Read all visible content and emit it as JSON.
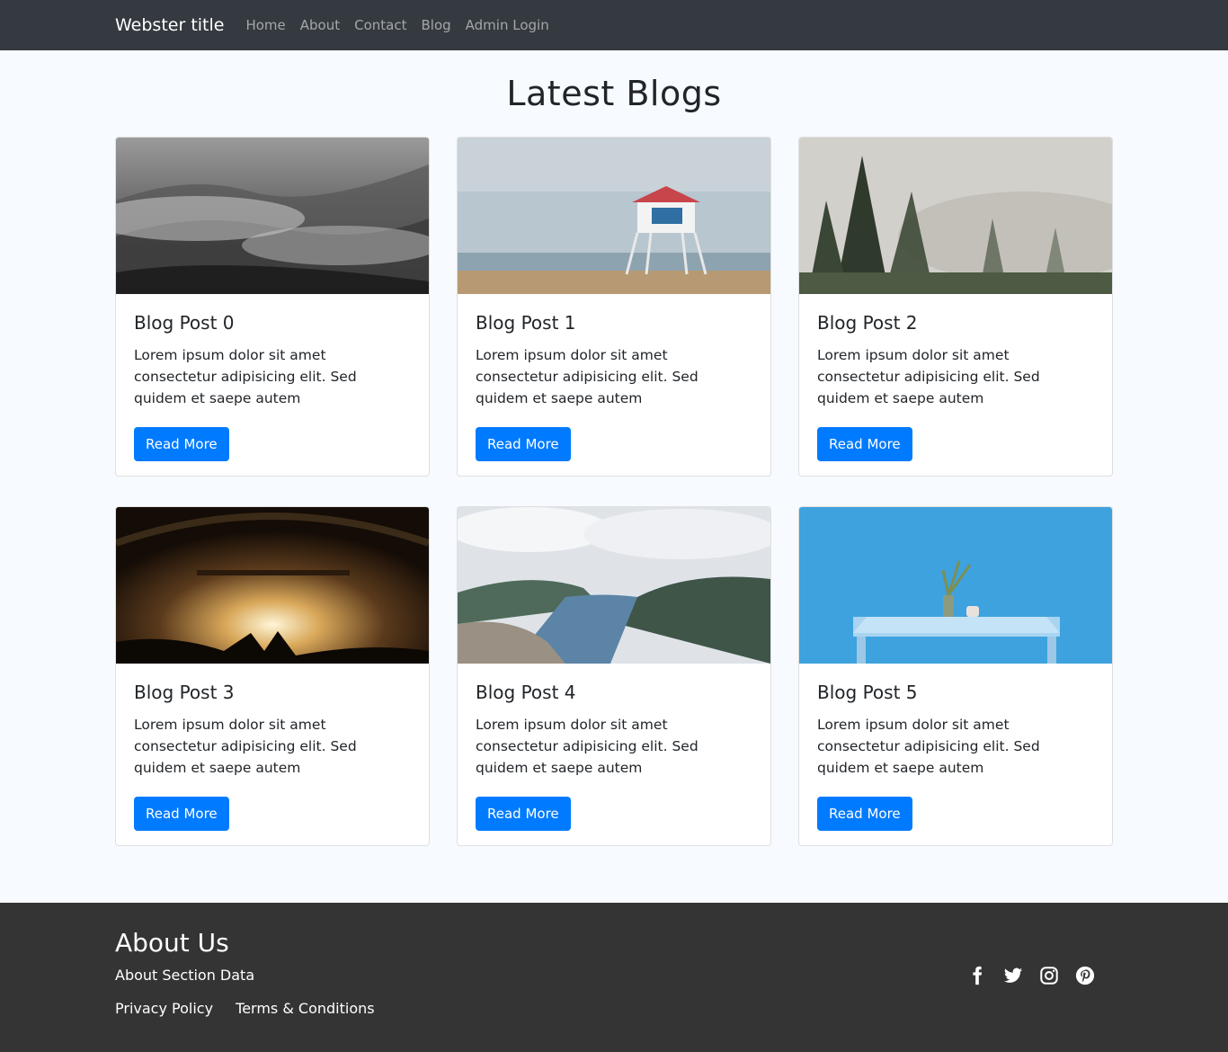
{
  "nav": {
    "brand": "Webster title",
    "links": [
      "Home",
      "About",
      "Contact",
      "Blog",
      "Admin Login"
    ]
  },
  "main": {
    "title": "Latest Blogs",
    "posts": [
      {
        "title": "Blog Post 0",
        "text": "Lorem ipsum dolor sit amet consectetur adipisicing elit. Sed quidem et saepe autem",
        "button": "Read More",
        "image": "misty-forest-grayscale"
      },
      {
        "title": "Blog Post 1",
        "text": "Lorem ipsum dolor sit amet consectetur adipisicing elit. Sed quidem et saepe autem",
        "button": "Read More",
        "image": "lifeguard-tower-beach"
      },
      {
        "title": "Blog Post 2",
        "text": "Lorem ipsum dolor sit amet consectetur adipisicing elit. Sed quidem et saepe autem",
        "button": "Read More",
        "image": "foggy-pine-trees"
      },
      {
        "title": "Blog Post 3",
        "text": "Lorem ipsum dolor sit amet consectetur adipisicing elit. Sed quidem et saepe autem",
        "button": "Read More",
        "image": "concert-crowd-stage"
      },
      {
        "title": "Blog Post 4",
        "text": "Lorem ipsum dolor sit amet consectetur adipisicing elit. Sed quidem et saepe autem",
        "button": "Read More",
        "image": "fjord-mountains"
      },
      {
        "title": "Blog Post 5",
        "text": "Lorem ipsum dolor sit amet consectetur adipisicing elit. Sed quidem et saepe autem",
        "button": "Read More",
        "image": "blue-wall-table"
      }
    ]
  },
  "footer": {
    "title": "About Us",
    "text": "About Section Data",
    "links": [
      "Privacy Policy",
      "Terms & Conditions"
    ],
    "social_icons": [
      "facebook-icon",
      "twitter-icon",
      "instagram-icon",
      "pinterest-icon"
    ]
  },
  "colors": {
    "navbar": "#343a40",
    "footer": "#343434",
    "primary": "#007bff",
    "page_bg": "#f7faff"
  }
}
